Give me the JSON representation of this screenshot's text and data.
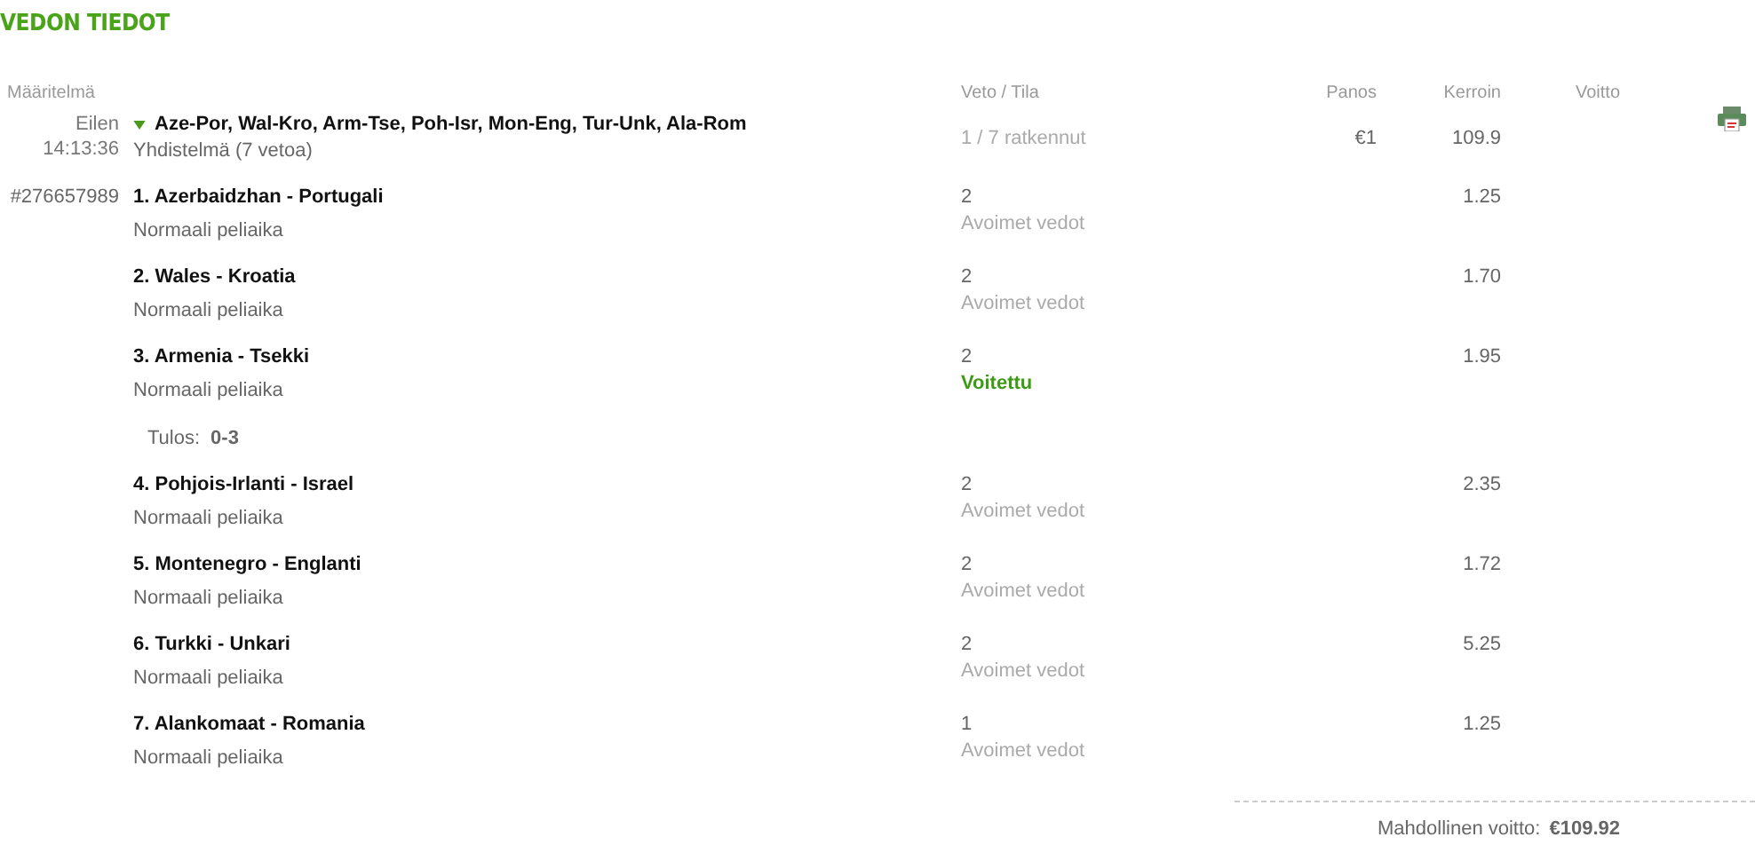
{
  "title": "VEDON TIEDOT",
  "columns": [
    "Määritelmä",
    "Veto / Tila",
    "Panos",
    "Kerroin",
    "Voitto"
  ],
  "bet": {
    "date": "Eilen",
    "time": "14:13:36",
    "expanded": true,
    "name": "Aze-Por, Wal-Kro, Arm-Tse, Poh-Isr, Mon-Eng, Tur-Unk, Ala-Rom",
    "type": "Yhdistelmä (7 vetoa)",
    "status": "1 / 7 ratkennut",
    "stake": "€1",
    "odds": "109.9",
    "id": "#276657989"
  },
  "selections": [
    {
      "match": "1. Azerbaidzhan - Portugali",
      "market": "Normaali peliaika",
      "pick": "2",
      "status": "Avoimet vedot",
      "won": false,
      "odds": "1.25"
    },
    {
      "match": "2. Wales - Kroatia",
      "market": "Normaali peliaika",
      "pick": "2",
      "status": "Avoimet vedot",
      "won": false,
      "odds": "1.70"
    },
    {
      "match": "3. Armenia - Tsekki",
      "market": "Normaali peliaika",
      "pick": "2",
      "status": "Voitettu",
      "won": true,
      "odds": "1.95",
      "result_label": "Tulos:",
      "result": "0-3"
    },
    {
      "match": "4. Pohjois-Irlanti - Israel",
      "market": "Normaali peliaika",
      "pick": "2",
      "status": "Avoimet vedot",
      "won": false,
      "odds": "2.35"
    },
    {
      "match": "5. Montenegro - Englanti",
      "market": "Normaali peliaika",
      "pick": "2",
      "status": "Avoimet vedot",
      "won": false,
      "odds": "1.72"
    },
    {
      "match": "6. Turkki - Unkari",
      "market": "Normaali peliaika",
      "pick": "2",
      "status": "Avoimet vedot",
      "won": false,
      "odds": "5.25"
    },
    {
      "match": "7. Alankomaat - Romania",
      "market": "Normaali peliaika",
      "pick": "1",
      "status": "Avoimet vedot",
      "won": false,
      "odds": "1.25"
    }
  ],
  "footer": {
    "label": "Mahdollinen voitto:",
    "value": "€109.92"
  }
}
